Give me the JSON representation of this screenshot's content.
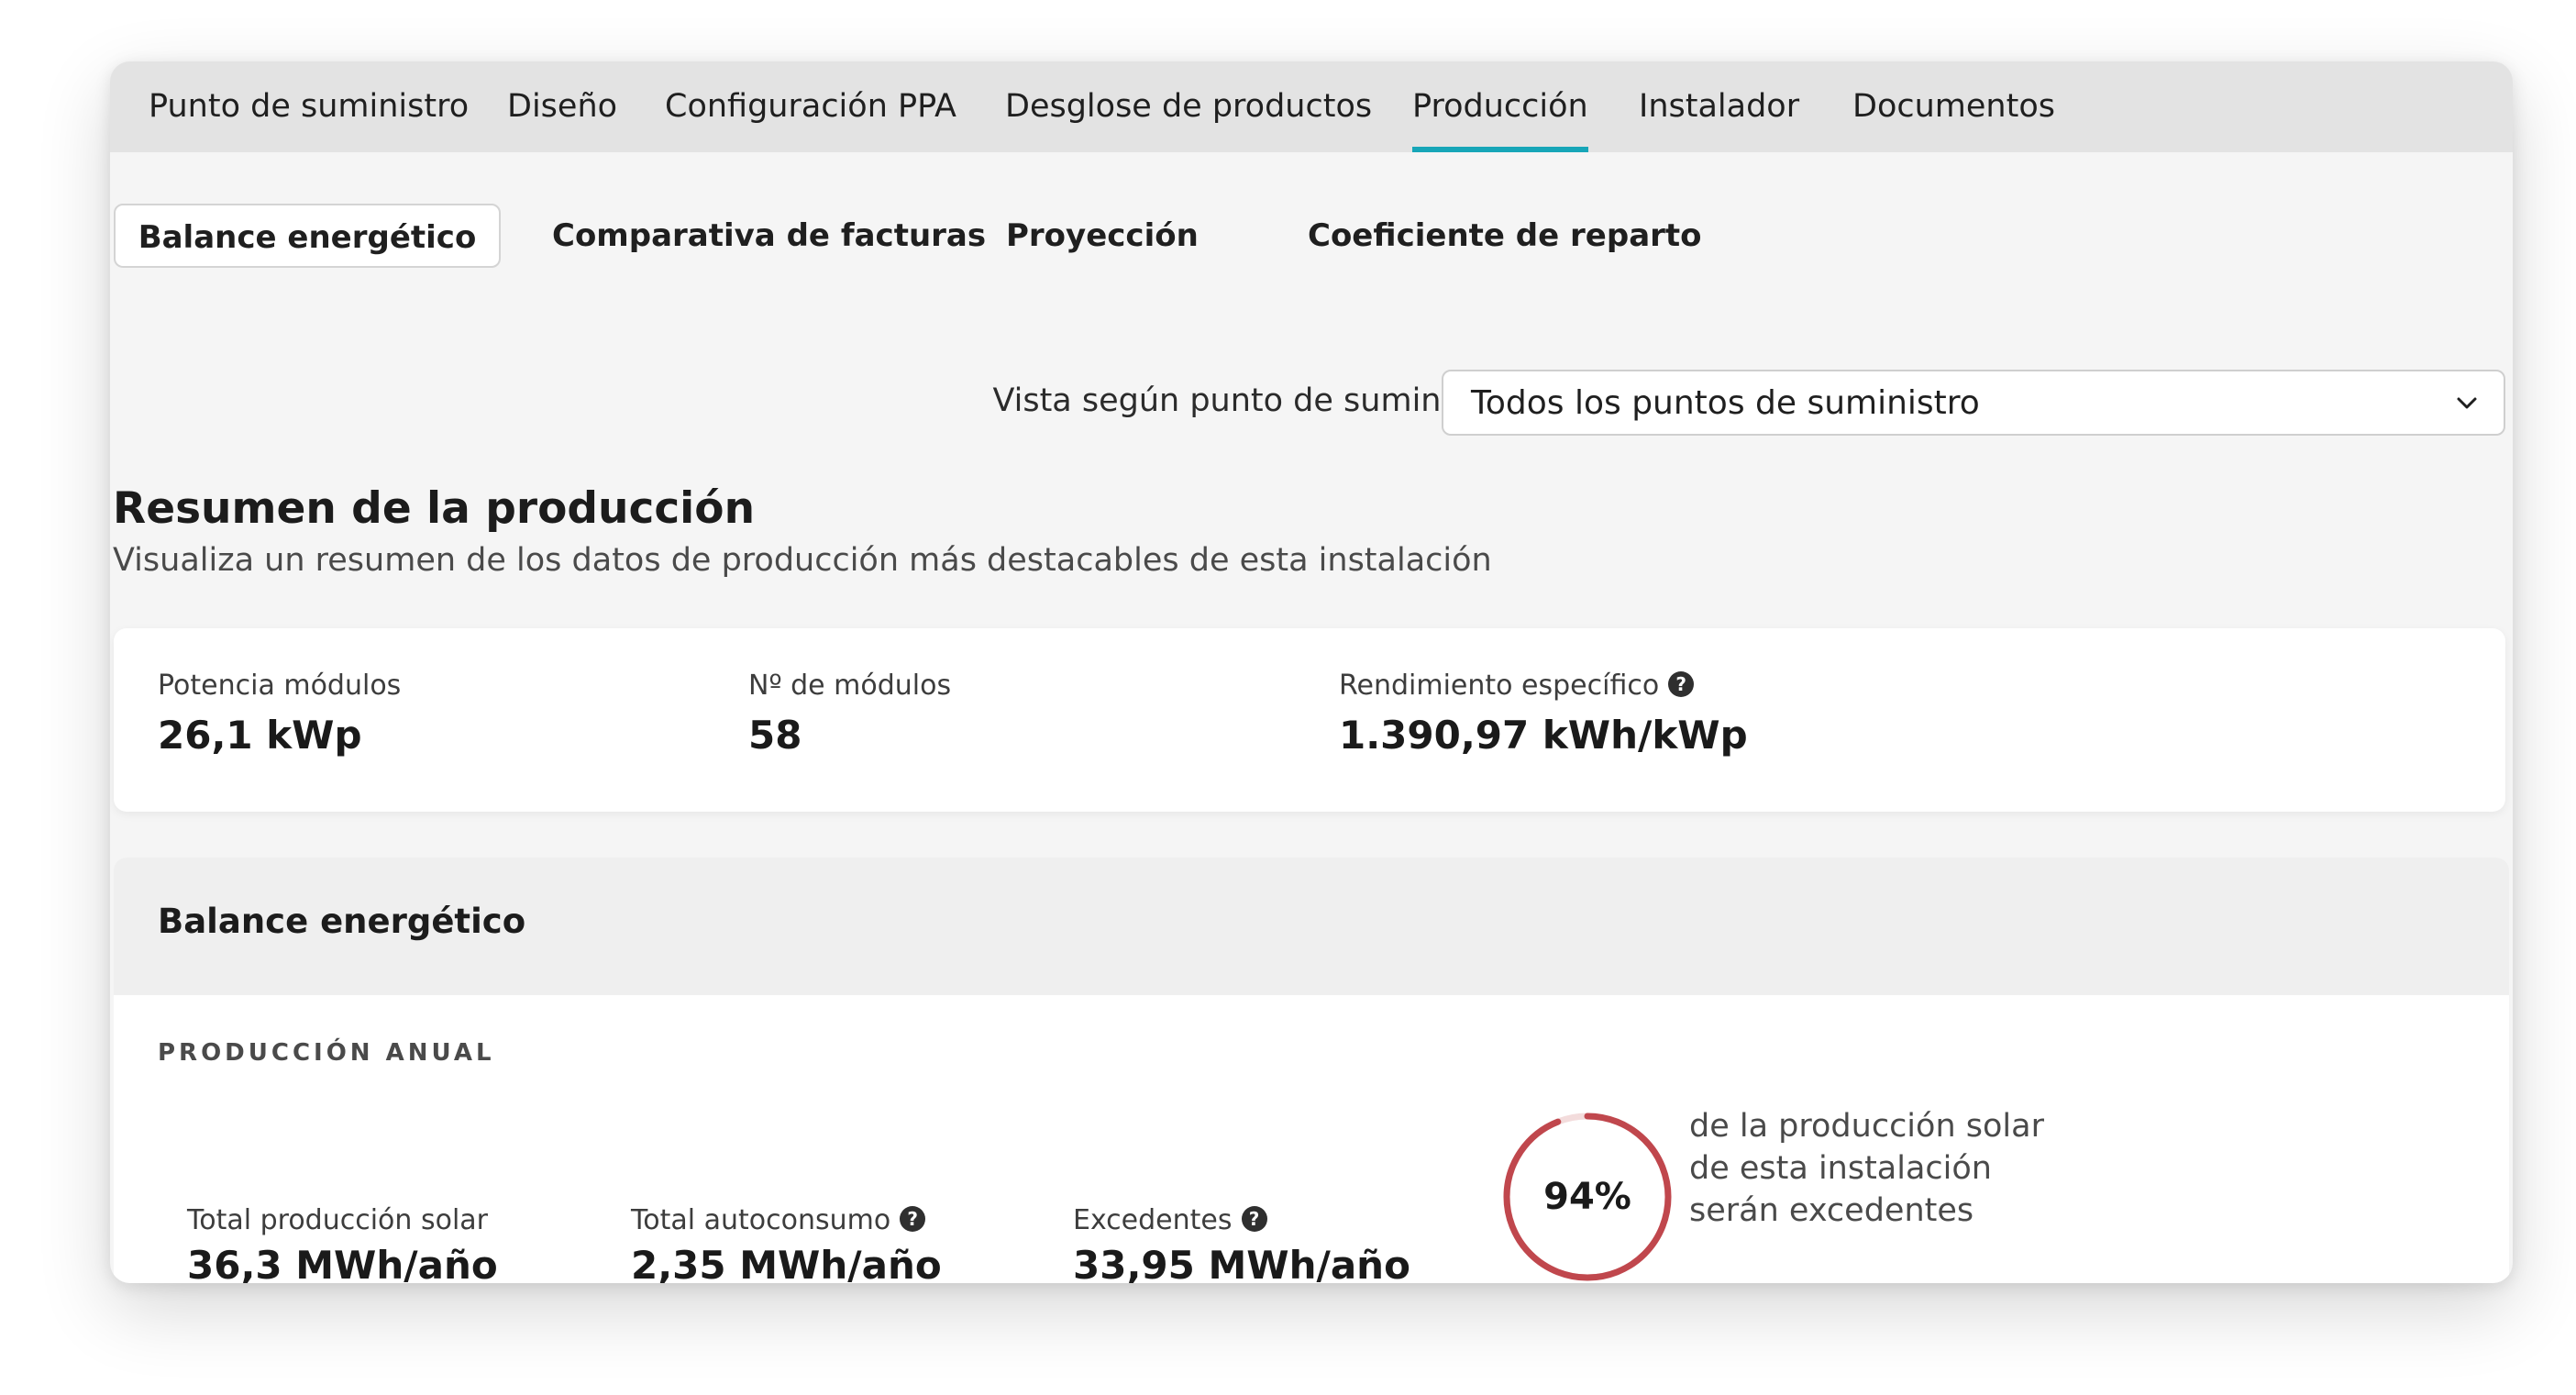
{
  "top_tabs": [
    {
      "label": "Punto de suministro"
    },
    {
      "label": "Diseño"
    },
    {
      "label": "Configuración PPA"
    },
    {
      "label": "Desglose de productos"
    },
    {
      "label": "Producción",
      "active": true
    },
    {
      "label": "Instalador"
    },
    {
      "label": "Documentos"
    }
  ],
  "sub_tabs": [
    {
      "label": "Balance energético",
      "active": true
    },
    {
      "label": "Comparativa de facturas"
    },
    {
      "label": "Proyección"
    },
    {
      "label": "Coeficiente de reparto"
    }
  ],
  "supply_view": {
    "label": "Vista según punto de suministro:",
    "selected": "Todos los puntos de suministro",
    "icon": "chevron-down-icon"
  },
  "summary": {
    "title": "Resumen de la producción",
    "subtitle": "Visualiza un resumen de los datos de producción más destacables de esta instalación",
    "metrics": [
      {
        "label": "Potencia módulos",
        "value": "26,1 kWp"
      },
      {
        "label": "Nº de módulos",
        "value": "58"
      },
      {
        "label": "Rendimiento específico",
        "value": "1.390,97 kWh/kWp",
        "help_icon": "help-circle-icon"
      }
    ]
  },
  "balance": {
    "title": "Balance energético",
    "section_label": "PRODUCCIÓN ANUAL",
    "metrics": [
      {
        "label": "Total producción solar",
        "value": "36,3 MWh/año"
      },
      {
        "label": "Total autoconsumo",
        "value": "2,35 MWh/año",
        "help_icon": "help-circle-icon"
      },
      {
        "label": "Excedentes",
        "value": "33,95 MWh/año",
        "help_icon": "help-circle-icon"
      }
    ],
    "surplus_gauge": {
      "percent_text": "94%",
      "fraction": 0.94,
      "caption_lines": [
        "de la producción solar",
        "de esta instalación",
        "serán excedentes"
      ],
      "ring_color": "#c0474d",
      "track_color": "#f3dcdc"
    }
  },
  "colors": {
    "accent": "#17a6b8",
    "tab_bar": "#e3e3e3",
    "background": "#f5f5f5"
  }
}
